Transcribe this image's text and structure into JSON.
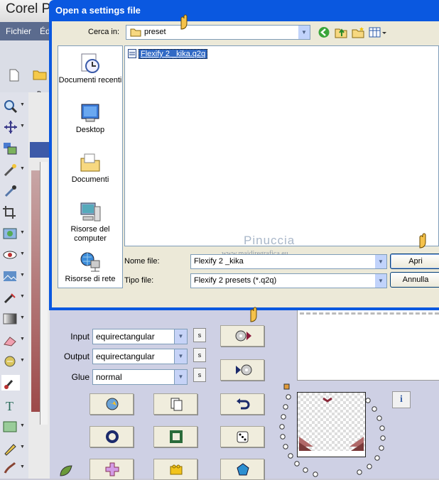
{
  "app": {
    "title": "Corel Pa",
    "menu": [
      "Fichier",
      "Éd"
    ],
    "toolbar_label": "Pa"
  },
  "dialog": {
    "title": "Open a settings file",
    "look_in_label": "Cerca in:",
    "look_in_value": "preset",
    "places": [
      {
        "label": "Documenti recenti",
        "icon": "recent-docs-icon"
      },
      {
        "label": "Desktop",
        "icon": "desktop-icon"
      },
      {
        "label": "Documenti",
        "icon": "documents-folder-icon"
      },
      {
        "label": "Risorse del computer",
        "icon": "computer-icon"
      },
      {
        "label": "Risorse di rete",
        "icon": "network-icon"
      }
    ],
    "files": [
      {
        "name": "Flexify 2 _kika.q2q",
        "selected": true
      }
    ],
    "file_name_label": "Nome file:",
    "file_name_value": "Flexify 2 _kika",
    "file_type_label": "Tipo file:",
    "file_type_value": "Flexify 2 presets (*.q2q)",
    "open_label": "Apri",
    "cancel_label": "Annulla",
    "watermark_name": "Pinuccia",
    "watermark_url": "www.maidiregrafica.eu"
  },
  "plugin": {
    "input_label": "Input",
    "input_value": "equirectangular",
    "output_label": "Output",
    "output_value": "equirectangular",
    "glue_label": "Glue",
    "glue_value": "normal",
    "s_label": "s",
    "info_label": "i"
  },
  "colors": {
    "dialog_title_bar": "#0a58e0",
    "selection": "#316ac5",
    "plugin_bg": "#ced0e4",
    "button_face": "#f0eddd"
  }
}
